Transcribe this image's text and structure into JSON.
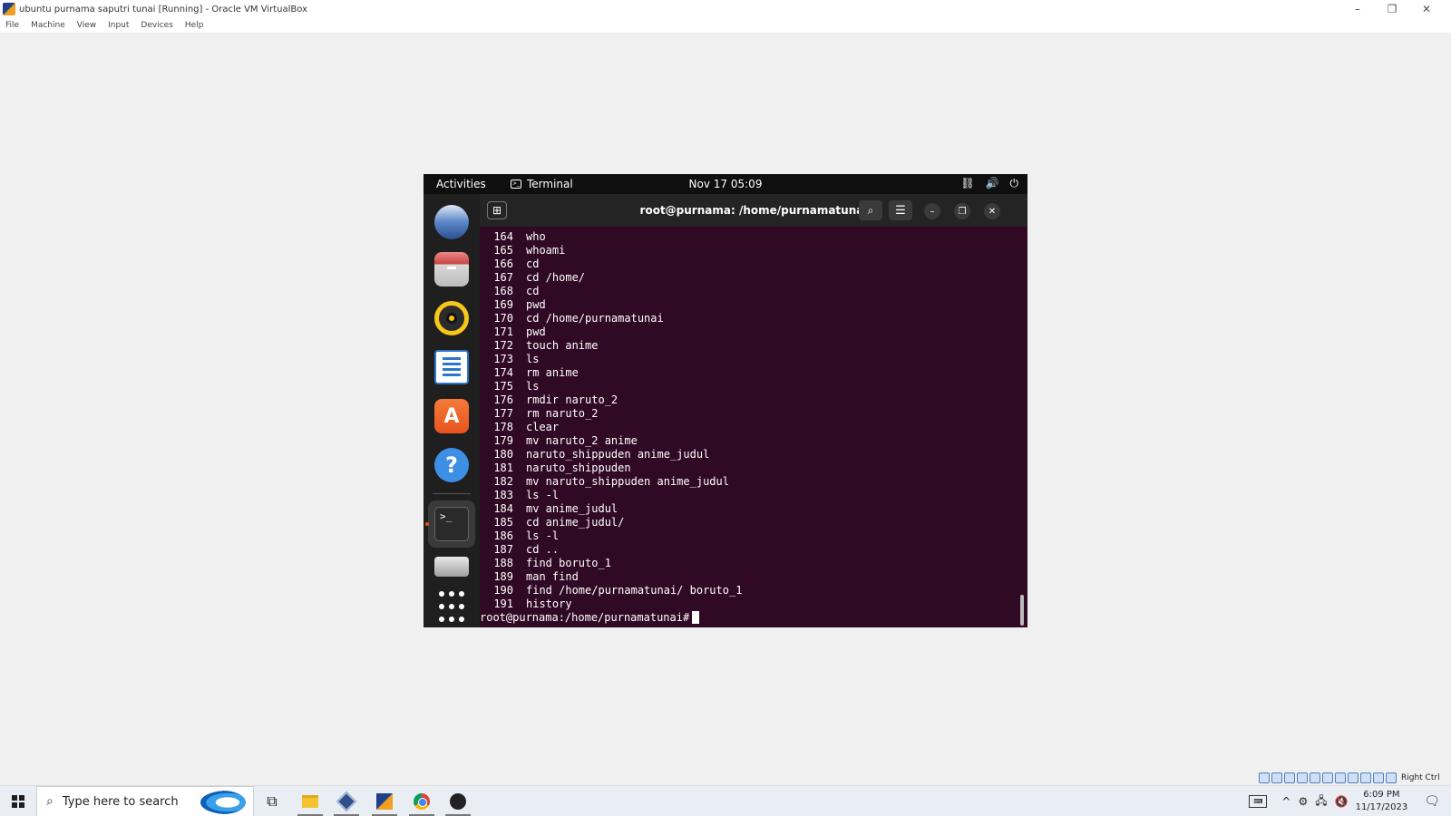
{
  "host": {
    "title": "ubuntu purnama saputri tunai [Running] - Oracle VM VirtualBox",
    "menu": [
      "File",
      "Machine",
      "View",
      "Input",
      "Devices",
      "Help"
    ],
    "window_controls": {
      "minimize": "–",
      "restore": "❐",
      "close": "✕"
    },
    "host_key": "Right Ctrl"
  },
  "vm": {
    "topbar": {
      "activities": "Activities",
      "app_name": "Terminal",
      "clock": "Nov 17  05:09"
    },
    "terminal": {
      "title": "root@purnama: /home/purnamatunai",
      "history": [
        {
          "num": "164",
          "cmd": "who"
        },
        {
          "num": "165",
          "cmd": "whoami"
        },
        {
          "num": "166",
          "cmd": "cd"
        },
        {
          "num": "167",
          "cmd": "cd /home/"
        },
        {
          "num": "168",
          "cmd": "cd"
        },
        {
          "num": "169",
          "cmd": "pwd"
        },
        {
          "num": "170",
          "cmd": "cd /home/purnamatunai"
        },
        {
          "num": "171",
          "cmd": "pwd"
        },
        {
          "num": "172",
          "cmd": "touch anime"
        },
        {
          "num": "173",
          "cmd": "ls"
        },
        {
          "num": "174",
          "cmd": "rm anime"
        },
        {
          "num": "175",
          "cmd": "ls"
        },
        {
          "num": "176",
          "cmd": "rmdir naruto_2"
        },
        {
          "num": "177",
          "cmd": "rm naruto_2"
        },
        {
          "num": "178",
          "cmd": "clear"
        },
        {
          "num": "179",
          "cmd": "mv naruto_2 anime"
        },
        {
          "num": "180",
          "cmd": "naruto_shippuden anime_judul"
        },
        {
          "num": "181",
          "cmd": "naruto_shippuden"
        },
        {
          "num": "182",
          "cmd": "mv naruto_shippuden anime_judul"
        },
        {
          "num": "183",
          "cmd": "ls -l"
        },
        {
          "num": "184",
          "cmd": "mv anime_judul"
        },
        {
          "num": "185",
          "cmd": "cd anime_judul/"
        },
        {
          "num": "186",
          "cmd": "ls -l"
        },
        {
          "num": "187",
          "cmd": "cd .."
        },
        {
          "num": "188",
          "cmd": "find boruto_1"
        },
        {
          "num": "189",
          "cmd": "man find"
        },
        {
          "num": "190",
          "cmd": "find /home/purnamatunai/ boruto_1"
        },
        {
          "num": "191",
          "cmd": "history"
        }
      ],
      "prompt": "root@purnama:/home/purnamatunai#"
    }
  },
  "taskbar": {
    "search_placeholder": "Type here to search",
    "time": "6:09 PM",
    "date": "11/17/2023"
  }
}
